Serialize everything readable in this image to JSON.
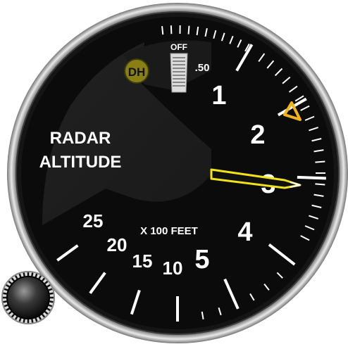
{
  "instrument": {
    "title_line1": "RADAR",
    "title_line2": "ALTITUDE",
    "units": "X 100 FEET",
    "dh_badge": "DH",
    "off_flag": "OFF",
    "minor_label": ".50",
    "major_labels": [
      "1",
      "2",
      "3",
      "4",
      "5"
    ],
    "compressed_labels": [
      "10",
      "15",
      "20",
      "25"
    ],
    "pointer_value_hundreds_ft": 3.0,
    "dh_bug_value_hundreds_ft": 2.0,
    "colors": {
      "dial": "#0b0b0b",
      "bezel": "#1a1a1a",
      "markings": "#ffffff",
      "pointer": "#f2e21a",
      "dh_bug": "#f2b21a",
      "dh_badge_bg": "#8a7f14",
      "off_flag": "#dcdcdc"
    }
  }
}
